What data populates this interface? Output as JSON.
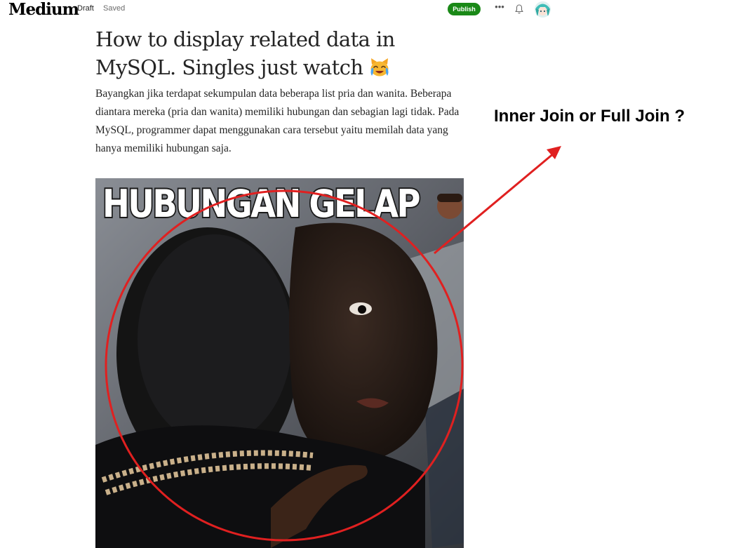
{
  "header": {
    "logo": "Medium",
    "draft_label": "Draft",
    "saved_label": "Saved",
    "publish_label": "Publish",
    "more_label": "•••"
  },
  "colors": {
    "publish_green": "#1a8917",
    "annotation_red": "#e02020"
  },
  "icons": {
    "more": "more-icon",
    "notifications": "bell-icon",
    "avatar": "avatar-icon",
    "title_emoji": "crying-cat-emoji"
  },
  "article": {
    "title": "How to display related data in MySQL. Singles just watch",
    "body": "Bayangkan jika terdapat sekumpulan data beberapa list pria dan wanita. Beberapa diantara mereka (pria dan wanita) memiliki hubungan dan sebagian lagi tidak. Pada MySQL, programmer dapat menggunakan cara tersebut yaitu memilah data yang hanya memiliki hubungan saja.",
    "image_caption": "HUBUNGAN GELAP"
  },
  "annotation": {
    "text": "Inner Join or Full Join ?"
  }
}
